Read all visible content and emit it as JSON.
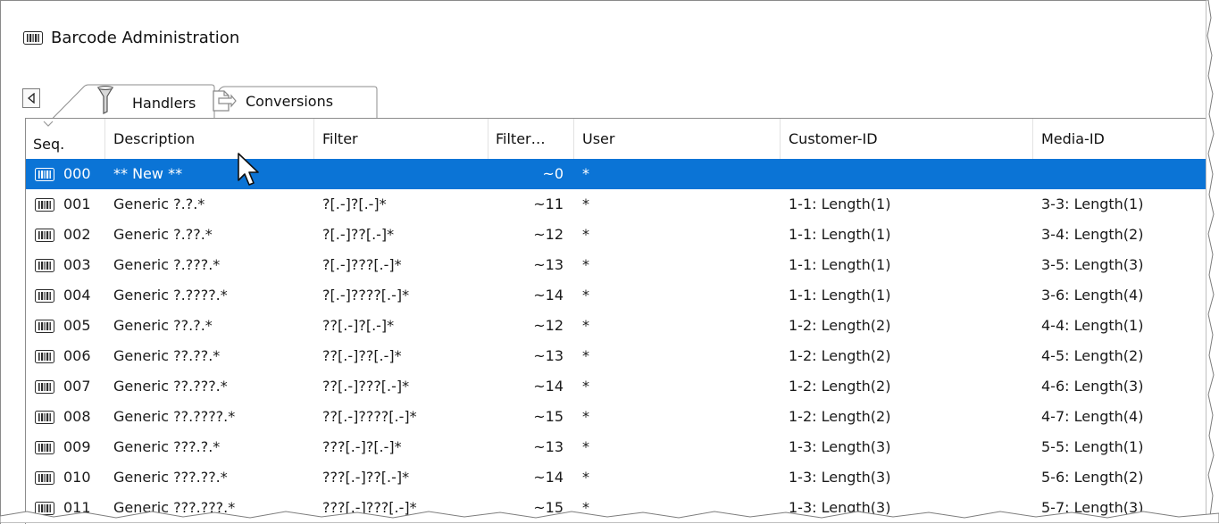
{
  "window": {
    "title": "Barcode Administration",
    "icon": "barcode-icon"
  },
  "tabs": [
    {
      "label": "Handlers",
      "icon": "funnel-icon",
      "active": true
    },
    {
      "label": "Conversions",
      "icon": "document-arrow-icon",
      "active": false
    }
  ],
  "grid": {
    "columns": [
      "Seq.",
      "Description",
      "Filter",
      "Filter…",
      "User",
      "Customer-ID",
      "Media-ID"
    ],
    "rows": [
      {
        "seq": "000",
        "description": "** New **",
        "filter": "",
        "filter_len": "~0",
        "user": "*",
        "customer_id": "",
        "media_id": "",
        "selected": true
      },
      {
        "seq": "001",
        "description": "Generic ?.?.*",
        "filter": "?[.-]?[.-]*",
        "filter_len": "~11",
        "user": "*",
        "customer_id": "1-1: Length(1)",
        "media_id": "3-3: Length(1)"
      },
      {
        "seq": "002",
        "description": "Generic ?.??.*",
        "filter": "?[.-]??[.-]*",
        "filter_len": "~12",
        "user": "*",
        "customer_id": "1-1: Length(1)",
        "media_id": "3-4: Length(2)"
      },
      {
        "seq": "003",
        "description": "Generic ?.???.*",
        "filter": "?[.-]???[.-]*",
        "filter_len": "~13",
        "user": "*",
        "customer_id": "1-1: Length(1)",
        "media_id": "3-5: Length(3)"
      },
      {
        "seq": "004",
        "description": "Generic ?.????.*",
        "filter": "?[.-]????[.-]*",
        "filter_len": "~14",
        "user": "*",
        "customer_id": "1-1: Length(1)",
        "media_id": "3-6: Length(4)"
      },
      {
        "seq": "005",
        "description": "Generic ??.?.*",
        "filter": "??[.-]?[.-]*",
        "filter_len": "~12",
        "user": "*",
        "customer_id": "1-2: Length(2)",
        "media_id": "4-4: Length(1)"
      },
      {
        "seq": "006",
        "description": "Generic ??.??.*",
        "filter": "??[.-]??[.-]*",
        "filter_len": "~13",
        "user": "*",
        "customer_id": "1-2: Length(2)",
        "media_id": "4-5: Length(2)"
      },
      {
        "seq": "007",
        "description": "Generic ??.???.*",
        "filter": "??[.-]???[.-]*",
        "filter_len": "~14",
        "user": "*",
        "customer_id": "1-2: Length(2)",
        "media_id": "4-6: Length(3)"
      },
      {
        "seq": "008",
        "description": "Generic ??.????.*",
        "filter": "??[.-]????[.-]*",
        "filter_len": "~15",
        "user": "*",
        "customer_id": "1-2: Length(2)",
        "media_id": "4-7: Length(4)"
      },
      {
        "seq": "009",
        "description": "Generic ???.?.*",
        "filter": "???[.-]?[.-]*",
        "filter_len": "~13",
        "user": "*",
        "customer_id": "1-3: Length(3)",
        "media_id": "5-5: Length(1)"
      },
      {
        "seq": "010",
        "description": "Generic ???.??.*",
        "filter": "???[.-]??[.-]*",
        "filter_len": "~14",
        "user": "*",
        "customer_id": "1-3: Length(3)",
        "media_id": "5-6: Length(2)"
      },
      {
        "seq": "011",
        "description": "Generic ???.???.*",
        "filter": "???[.-]???[.-]*",
        "filter_len": "~15",
        "user": "*",
        "customer_id": "1-3: Length(3)",
        "media_id": "5-7: Length(3)"
      }
    ]
  },
  "colors": {
    "selection": "#0b74d6",
    "border": "#8c8c8c",
    "icon": "#3a3a3a"
  }
}
